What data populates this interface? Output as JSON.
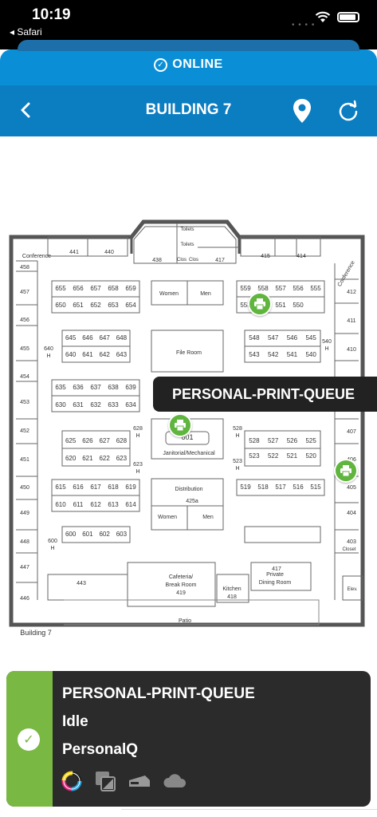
{
  "status_bar": {
    "time": "10:19",
    "back_app": "Safari"
  },
  "connection": {
    "label": "ONLINE"
  },
  "header": {
    "title": "BUILDING 7"
  },
  "map": {
    "building_label": "Building 7",
    "rooms": {
      "conference_left": "Conference",
      "conference_right": "Conference",
      "toilets1": "Toilets",
      "toilets2": "Toilets",
      "clos1": "Clos",
      "clos2": "Clos",
      "women_top": "Women",
      "men_top": "Men",
      "file_room": "File Room",
      "janitorial": "Janitorial/Mechanical",
      "distribution": "Distribution",
      "r425a": "425a",
      "women_bot": "Women",
      "men_bot": "Men",
      "cafeteria": "Cafeteria/",
      "break_room": "Break Room",
      "r419": "419",
      "kitchen": "Kitchen",
      "r418": "418",
      "r417": "417",
      "private": "Private",
      "dining": "Dining Room",
      "patio": "Patio",
      "closet": "Closet",
      "elev": "Elev.",
      "r601": "601"
    },
    "top_rooms": [
      "441",
      "440",
      "438",
      "417",
      "415",
      "414"
    ],
    "left_rooms": [
      "458",
      "457",
      "456",
      "455",
      "454",
      "453",
      "452",
      "451",
      "450",
      "449",
      "448",
      "447",
      "446"
    ],
    "right_rooms": [
      "412",
      "411",
      "410",
      "407",
      "406",
      "405",
      "404",
      "403"
    ],
    "cubes_655": [
      "655",
      "656",
      "657",
      "658",
      "659"
    ],
    "cubes_650": [
      "650",
      "651",
      "652",
      "653",
      "654"
    ],
    "cubes_645": [
      "645",
      "646",
      "647",
      "648"
    ],
    "cubes_640": [
      "640",
      "641",
      "642",
      "643"
    ],
    "cubes_635": [
      "635",
      "636",
      "637",
      "638",
      "639"
    ],
    "cubes_630": [
      "630",
      "631",
      "632",
      "633",
      "634"
    ],
    "cubes_625": [
      "625",
      "626",
      "627",
      "628"
    ],
    "cubes_620": [
      "620",
      "621",
      "622",
      "623"
    ],
    "cubes_615": [
      "615",
      "616",
      "617",
      "618",
      "619"
    ],
    "cubes_610": [
      "610",
      "611",
      "612",
      "613",
      "614"
    ],
    "cubes_600": [
      "600",
      "601",
      "602",
      "603"
    ],
    "cubes_559": [
      "559",
      "558",
      "557",
      "556",
      "555"
    ],
    "cubes_553": [
      "553",
      "552",
      "551",
      "550"
    ],
    "cubes_548": [
      "548",
      "547",
      "546",
      "545"
    ],
    "cubes_543": [
      "543",
      "542",
      "541",
      "540"
    ],
    "cubes_528": [
      "528",
      "527",
      "526",
      "525"
    ],
    "cubes_523": [
      "523",
      "522",
      "521",
      "520"
    ],
    "cubes_519": [
      "519",
      "518",
      "517",
      "516",
      "515"
    ],
    "labels_h": {
      "h640": "640",
      "h628": "628",
      "h623": "623",
      "h600": "600",
      "h540": "540",
      "h528": "528",
      "h523": "523",
      "h": "H",
      "r443": "443"
    }
  },
  "tooltip": {
    "text": "PERSONAL-PRINT-QUEUE"
  },
  "printer_card": {
    "name": "PERSONAL-PRINT-QUEUE",
    "status": "Idle",
    "queue": "PersonalQ",
    "status_color": "#79b843",
    "capabilities": [
      "color-icon",
      "duplex-icon",
      "staple-icon",
      "cloud-icon"
    ]
  }
}
